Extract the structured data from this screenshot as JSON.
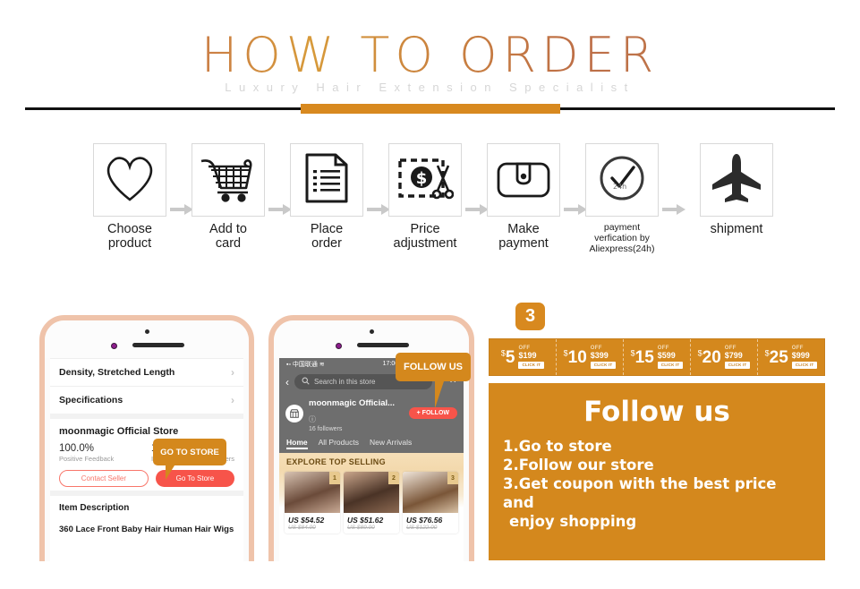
{
  "header": {
    "title": "HOW TO ORDER",
    "subtitle": "Luxury Hair Extension Specialist",
    "accent_color": "#d8891f",
    "rule_color": "#111111"
  },
  "steps": [
    {
      "icon": "heart-icon",
      "label": "Choose\nproduct",
      "small": false
    },
    {
      "icon": "shopping-cart-icon",
      "label": "Add to\ncard",
      "small": false
    },
    {
      "icon": "document-icon",
      "label": "Place\norder",
      "small": false
    },
    {
      "icon": "price-tag-scissors-icon",
      "label": "Price\nadjustment",
      "small": false
    },
    {
      "icon": "wallet-icon",
      "label": "Make\npayment",
      "small": false
    },
    {
      "icon": "clock-check-24h-icon",
      "label": "payment\nverfication by\nAliexpress(24h)",
      "small": true
    },
    {
      "icon": "airplane-icon",
      "label": "shipment",
      "small": false
    }
  ],
  "arrow_icon": "arrow-right-icon",
  "clock_icon_label": "24h",
  "phone1": {
    "rows": [
      {
        "label": "Density, Stretched Length",
        "chevron": "›"
      },
      {
        "label": "Specifications",
        "chevron": "›"
      }
    ],
    "store_name": "moonmagic Official Store",
    "stats": [
      {
        "value": "100.0%",
        "key": "Positive Feedback"
      },
      {
        "value": "157",
        "key": "Items"
      },
      {
        "value": "16",
        "key": "Followers"
      }
    ],
    "buttons": {
      "contact_seller": "Contact Seller",
      "go_to_store": "Go To Store"
    },
    "description_heading": "Item Description",
    "description_text": "360 Lace Front Baby Hair Human Hair Wigs",
    "callout": "GO TO STORE"
  },
  "phone2": {
    "status": {
      "carrier": "中国联通",
      "signal_icon": "signal-icon",
      "wifi_icon": "wifi-icon",
      "time": "17:06"
    },
    "back_icon": "back-chevron-icon",
    "search_icon": "search-icon",
    "search_placeholder": "Search in this store",
    "share_icon": "share-icon",
    "more_icon": "more-dots-icon",
    "store_avatar_icon": "store-icon",
    "store_name": "moonmagic Official...",
    "info_icon": "info-icon",
    "followers": "16  followers",
    "follow_button": "+ FOLLOW",
    "tabs": [
      {
        "label": "Home",
        "active": true
      },
      {
        "label": "All Products",
        "active": false
      },
      {
        "label": "New Arrivals",
        "active": false
      }
    ],
    "banner_title": "EXPLORE TOP SELLING",
    "products": [
      {
        "rank": "1",
        "price": "US $54.52",
        "old_price": "US $84.00"
      },
      {
        "rank": "2",
        "price": "US $51.62",
        "old_price": "US $89.00"
      },
      {
        "rank": "3",
        "price": "US $76.56",
        "old_price": "US $122.00"
      }
    ],
    "callout": "FOLLOW US"
  },
  "right_panel": {
    "badge": "3",
    "coupons": [
      {
        "currency": "$",
        "amount": "5",
        "off": "OFF",
        "min": "$199",
        "button": "CLICK IT"
      },
      {
        "currency": "$",
        "amount": "10",
        "off": "OFF",
        "min": "$399",
        "button": "CLICK IT"
      },
      {
        "currency": "$",
        "amount": "15",
        "off": "OFF",
        "min": "$599",
        "button": "CLICK IT"
      },
      {
        "currency": "$",
        "amount": "20",
        "off": "OFF",
        "min": "$799",
        "button": "CLICK IT"
      },
      {
        "currency": "$",
        "amount": "25",
        "off": "OFF",
        "min": "$999",
        "button": "CLICK IT"
      }
    ],
    "follow_title": "Follow us",
    "follow_steps": [
      "1.Go to store",
      "2.Follow our store",
      "3.Get coupon with the best price and",
      "enjoy shopping"
    ],
    "panel_color": "#d4881d"
  }
}
